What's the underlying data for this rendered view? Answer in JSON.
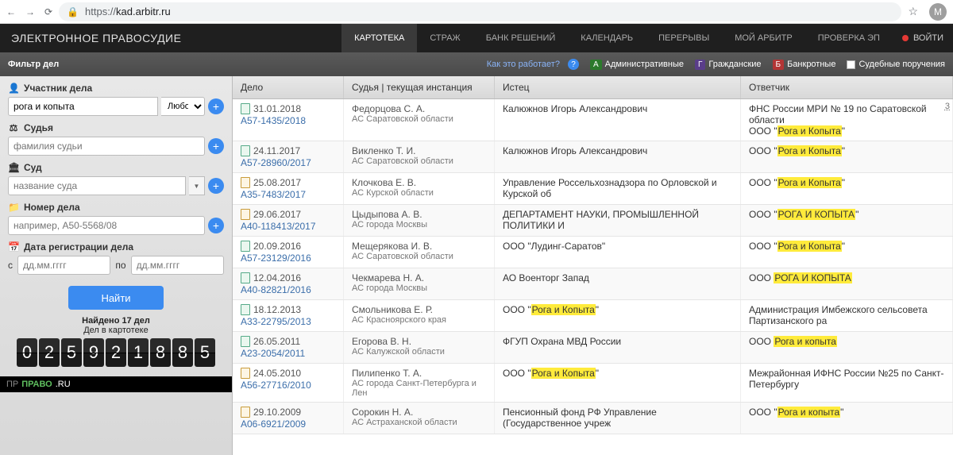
{
  "browser": {
    "url_proto": "https://",
    "url_host": "kad.arbitr.ru",
    "avatar": "M"
  },
  "header": {
    "title": "ЭЛЕКТРОННОЕ ПРАВОСУДИЕ",
    "tabs": [
      "КАРТОТЕКА",
      "СТРАЖ",
      "БАНК РЕШЕНИЙ",
      "КАЛЕНДАРЬ",
      "ПЕРЕРЫВЫ",
      "МОЙ АРБИТР",
      "ПРОВЕРКА ЭП"
    ],
    "login": "ВОЙТИ"
  },
  "filterbar": {
    "title": "Фильтр дел",
    "how": "Как это работает?",
    "cat_admin": "Административные",
    "cat_civil": "Гражданские",
    "cat_bank": "Банкротные",
    "cat_assign": "Судебные поручения"
  },
  "sidebar": {
    "participant_label": "Участник дела",
    "participant_value": "рога и копыта",
    "participant_type": "Любой",
    "judge_label": "Судья",
    "judge_placeholder": "фамилия судьи",
    "court_label": "Суд",
    "court_placeholder": "название суда",
    "case_label": "Номер дела",
    "case_placeholder": "например, А50-5568/08",
    "date_label": "Дата регистрации дела",
    "date_from": "с",
    "date_to": "по",
    "date_placeholder": "дд.мм.гггг",
    "find": "Найти",
    "found": "Найдено 17 дел",
    "total_label": "Дел в картотеке",
    "counter": [
      "0",
      "2",
      "5",
      "9",
      "2",
      "1",
      "8",
      "8",
      "5"
    ],
    "pravo": "ПРАВО",
    "pravo_suffix": ".RU"
  },
  "table": {
    "headers": {
      "case": "Дело",
      "judge": "Судья | текущая инстанция",
      "plf": "Истец",
      "def": "Ответчик"
    },
    "right_count": "3",
    "rows": [
      {
        "ico": "g",
        "date": "31.01.2018",
        "num": "А57-1435/2018",
        "judge": "Федорцова С. А.",
        "court": "АС Саратовской области",
        "plf": "Калюжнов Игорь Александрович",
        "def_pre": "ФНС России МРИ № 19 по Саратовской области\nООО \"",
        "def_hl": "Рога и Копыта",
        "def_post": "\""
      },
      {
        "ico": "g",
        "date": "24.11.2017",
        "num": "А57-28960/2017",
        "judge": "Викленко Т. И.",
        "court": "АС Саратовской области",
        "plf": "Калюжнов Игорь Александрович",
        "def_pre": "ООО \"",
        "def_hl": "Рога и Копыта",
        "def_post": "\""
      },
      {
        "ico": "a",
        "date": "25.08.2017",
        "num": "А35-7483/2017",
        "judge": "Клочкова Е. В.",
        "court": "АС Курской области",
        "plf": "Управление Россельхознадзора по Орловской и Курской об",
        "def_pre": "ООО \"",
        "def_hl": "Рога и Копыта",
        "def_post": "\""
      },
      {
        "ico": "a",
        "date": "29.06.2017",
        "num": "А40-118413/2017",
        "judge": "Цыдыпова А. В.",
        "court": "АС города Москвы",
        "plf": "ДЕПАРТАМЕНТ НАУКИ, ПРОМЫШЛЕННОЙ ПОЛИТИКИ И",
        "def_pre": "ООО \"",
        "def_hl": "РОГА И КОПЫТА",
        "def_post": "\""
      },
      {
        "ico": "g",
        "date": "20.09.2016",
        "num": "А57-23129/2016",
        "judge": "Мещерякова И. В.",
        "court": "АС Саратовской области",
        "plf": "ООО \"Лудинг-Саратов\"",
        "def_pre": "ООО \"",
        "def_hl": "Рога и Копыта",
        "def_post": "\""
      },
      {
        "ico": "g",
        "date": "12.04.2016",
        "num": "А40-82821/2016",
        "judge": "Чекмарева Н. А.",
        "court": "АС города Москвы",
        "plf": "АО Военторг Запад",
        "def_pre": "ООО ",
        "def_hl": "РОГА И КОПЫТА",
        "def_post": ""
      },
      {
        "ico": "g",
        "date": "18.12.2013",
        "num": "А33-22795/2013",
        "judge": "Смольникова Е. Р.",
        "court": "АС Красноярского края",
        "plf_pre": "ООО \"",
        "plf_hl": "Рога и Копыта",
        "plf_post": "\"",
        "def_plain": "Администрация Имбежского сельсовета Партизанского ра"
      },
      {
        "ico": "g",
        "date": "26.05.2011",
        "num": "А23-2054/2011",
        "judge": "Егорова В. Н.",
        "court": "АС Калужской области",
        "plf": "ФГУП Охрана МВД России",
        "def_pre": "ООО ",
        "def_hl": "Рога и копыта",
        "def_post": ""
      },
      {
        "ico": "a",
        "date": "24.05.2010",
        "num": "А56-27716/2010",
        "judge": "Пилипенко Т. А.",
        "court": "АС города Санкт-Петербурга и Лен",
        "plf_pre": "ООО \"",
        "plf_hl": "Рога и Копыта",
        "plf_post": "\"",
        "def_plain": "Межрайонная ИФНС России №25 по Санкт-Петербургу"
      },
      {
        "ico": "a",
        "date": "29.10.2009",
        "num": "А06-6921/2009",
        "judge": "Сорокин Н. А.",
        "court": "АС Астраханской области",
        "plf": "Пенсионный фонд РФ Управление (Государственное учреж",
        "def_pre": "ООО \"",
        "def_hl": "Рога и копыта",
        "def_post": "\""
      }
    ]
  }
}
